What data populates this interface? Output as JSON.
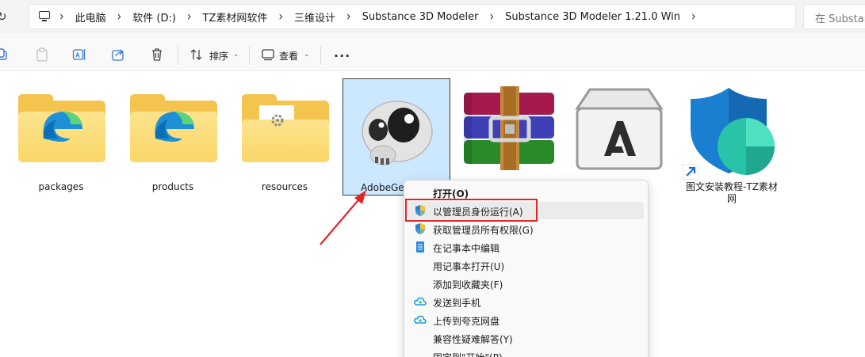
{
  "address_bar": {
    "crumbs": [
      "此电脑",
      "软件 (D:)",
      "TZ素材网软件",
      "三维设计",
      "Substance 3D Modeler",
      "Substance 3D Modeler 1.21.0 Win"
    ],
    "search_placeholder": "在 Substance"
  },
  "command_bar": {
    "sort_label": "排序",
    "view_label": "查看",
    "more_label": "···"
  },
  "files": [
    {
      "name": "packages",
      "type": "folder"
    },
    {
      "name": "products",
      "type": "folder"
    },
    {
      "name": "resources",
      "type": "folder"
    },
    {
      "name": "AdobeGe",
      "type": "exe",
      "selected": true
    },
    {
      "name": "",
      "type": "archive"
    },
    {
      "name": "",
      "type": "adobe-package"
    },
    {
      "name": "图文安装教程-TZ素材网",
      "type": "shortcut"
    }
  ],
  "context_menu": {
    "items": [
      {
        "label": "打开(O)",
        "bold": true,
        "icon": ""
      },
      {
        "label": "以管理员身份运行(A)",
        "icon": "uac-shield-icon",
        "highlighted": true
      },
      {
        "label": "获取管理员所有权限(G)",
        "icon": "uac-shield-icon"
      },
      {
        "label": "在记事本中编辑",
        "icon": "notepad-icon"
      },
      {
        "label": "用记事本打开(U)",
        "icon": ""
      },
      {
        "label": "添加到收藏夹(F)",
        "icon": ""
      },
      {
        "label": "发送到手机",
        "icon": "cloud-icon"
      },
      {
        "label": "上传到夸克网盘",
        "icon": "cloud-icon"
      },
      {
        "label": "兼容性疑难解答(Y)",
        "icon": ""
      },
      {
        "label": "固定到\"开始\"(P)",
        "icon": ""
      }
    ]
  },
  "annotation_color": "#e0262b"
}
